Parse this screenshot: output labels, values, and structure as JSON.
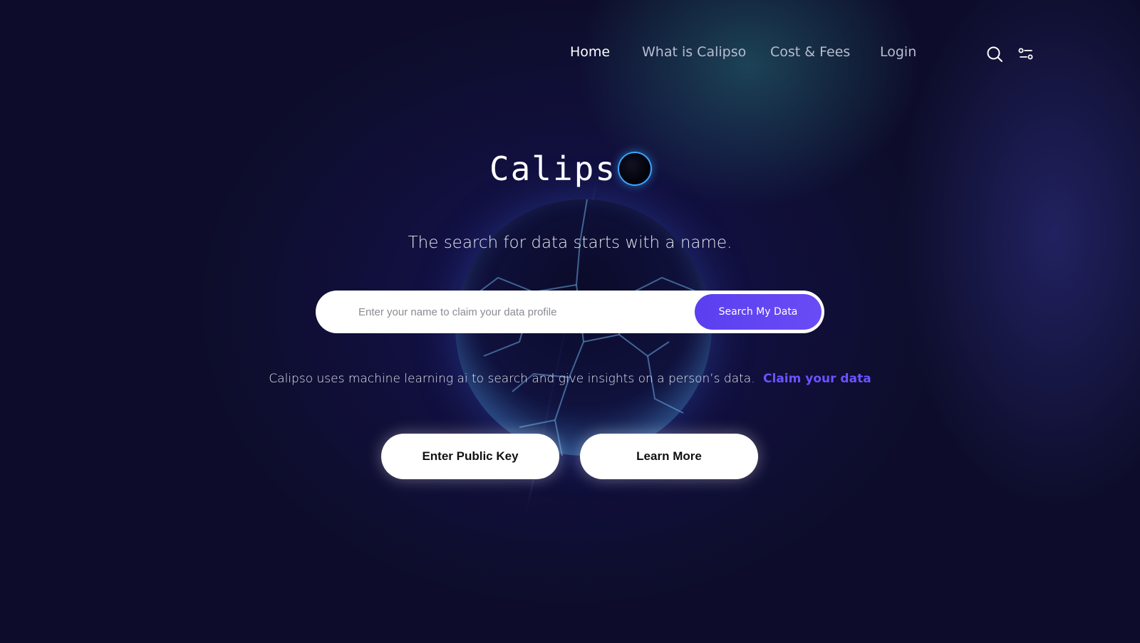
{
  "nav": {
    "links": [
      "Home",
      "What is Calipso",
      "Cost & Fees",
      "Login"
    ],
    "active": "Home",
    "icons": [
      "search-icon",
      "settings-toggle-icon"
    ]
  },
  "logo": {
    "text": "Calips"
  },
  "hero": {
    "tagline": "The search for data starts with a name.",
    "search_placeholder": "Enter your name to claim your data profile",
    "search_button": "Search My Data",
    "info_text": "Calipso uses machine learning ai to search and give insights on a person’s data.",
    "info_link": "Claim your data"
  },
  "actions": {
    "public_key": "Enter Public Key",
    "learn_more": "Learn More"
  },
  "colors": {
    "background": "#0d0d2b",
    "accent": "#5b3ff0",
    "link": "#6b53ff",
    "orb_glow": "#3aa8ff"
  }
}
